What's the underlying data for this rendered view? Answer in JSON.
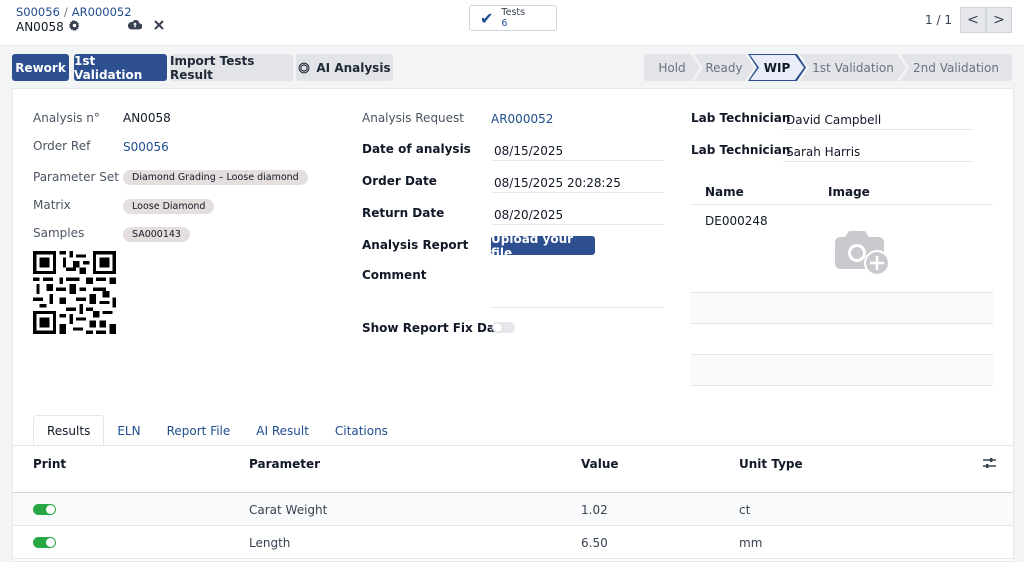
{
  "breadcrumb": {
    "parent": "S00056",
    "current": "AR000052",
    "record": "AN0058"
  },
  "icons": {
    "settings": "gear-icon",
    "save": "cloud-upload-icon",
    "discard": "close-icon",
    "tests": "check-icon",
    "ai": "openai-icon",
    "camera": "camera-plus-icon",
    "optional": "sliders-icon"
  },
  "smart_button": {
    "label": "Tests",
    "count": "6"
  },
  "pager": {
    "value": "1 / 1",
    "prev": "<",
    "next": ">"
  },
  "actions": {
    "rework": "Rework",
    "first_validation": "1st Validation",
    "import": "Import Tests Result",
    "ai_analysis": "AI Analysis"
  },
  "statusbar": [
    "Hold",
    "Ready",
    "WIP",
    "1st Validation",
    "2nd Validation"
  ],
  "statusbar_active": "WIP",
  "left": {
    "analysis_label": "Analysis n°",
    "analysis_value": "AN0058",
    "order_ref_label": "Order Ref",
    "order_ref_value": "S00056",
    "param_set_label": "Parameter Set",
    "param_set_value": "Diamond Grading – Loose diamond",
    "matrix_label": "Matrix",
    "matrix_value": "Loose Diamond",
    "samples_label": "Samples",
    "samples_value": "SA000143"
  },
  "middle": {
    "request_label": "Analysis Request",
    "request_value": "AR000052",
    "date_analysis_label": "Date of analysis",
    "date_analysis_value": "08/15/2025",
    "order_date_label": "Order Date",
    "order_date_value": "08/15/2025 20:28:25",
    "return_date_label": "Return Date",
    "return_date_value": "08/20/2025",
    "report_label": "Analysis Report",
    "upload_label": "Upload your file",
    "comment_label": "Comment",
    "fix_data_label": "Show Report Fix Data"
  },
  "right": {
    "tech1_label": "Lab Technician",
    "tech1_value": "David Campbell",
    "tech2_label": "Lab Technician",
    "tech2_value": "Sarah Harris",
    "col_name": "Name",
    "col_image": "Image",
    "rows": [
      {
        "name": "DE000248"
      }
    ]
  },
  "tabs": [
    "Results",
    "ELN",
    "Report File",
    "AI Result",
    "Citations"
  ],
  "results": {
    "headers": {
      "print": "Print",
      "parameter": "Parameter",
      "value": "Value",
      "unit": "Unit Type"
    },
    "rows": [
      {
        "print": true,
        "parameter": "Carat Weight",
        "value": "1.02",
        "unit": "ct"
      },
      {
        "print": true,
        "parameter": "Length",
        "value": "6.50",
        "unit": "mm"
      }
    ]
  },
  "colors": {
    "primary": "#2d4f90",
    "link": "#1f4d8f",
    "toggle_on": "#28a745",
    "tag_bg": "#e5dede"
  }
}
